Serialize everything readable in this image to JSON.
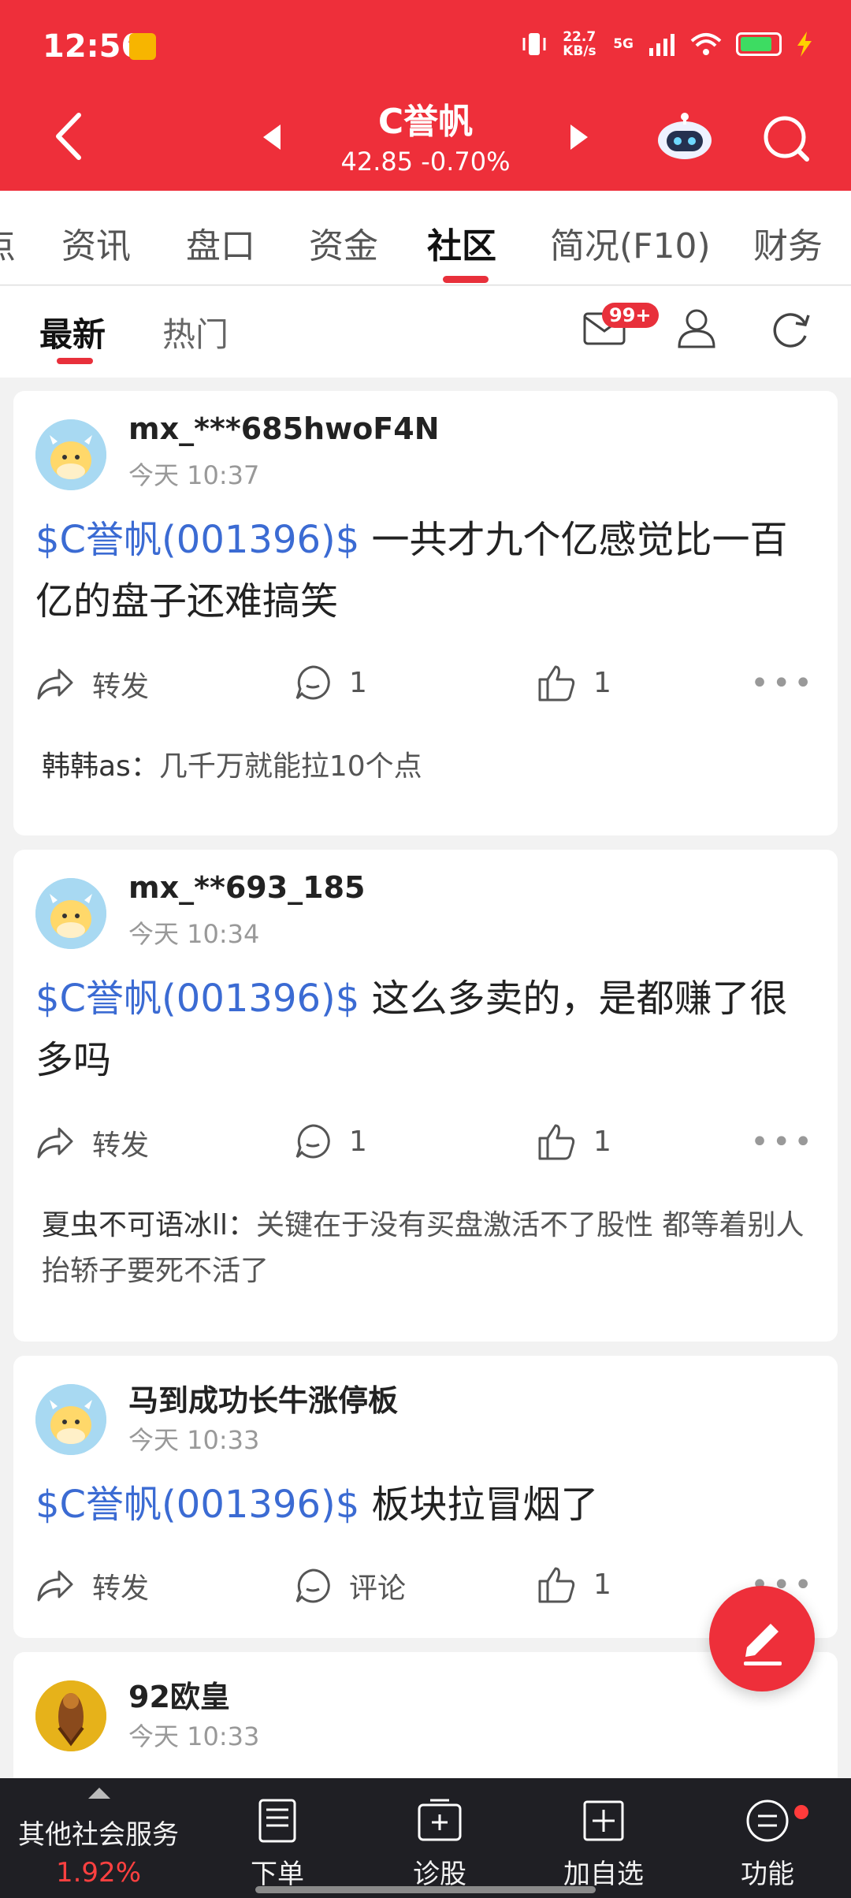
{
  "status_bar": {
    "time": "12:56",
    "net_speed": "22.7 KB/s",
    "network": "5G"
  },
  "header": {
    "stock_name": "C誉帆",
    "price_line": "42.85 -0.70%"
  },
  "tabs": [
    "点",
    "资讯",
    "盘口",
    "资金",
    "社区",
    "简况(F10)",
    "财务"
  ],
  "active_tab": "社区",
  "subtabs": {
    "latest": "最新",
    "hot": "热门"
  },
  "mail_badge": "99+",
  "posts": [
    {
      "user": "mx_***685hwoF4N",
      "time": "今天 10:37",
      "stock_tag": "$C誉帆(001396)$",
      "text": " 一共才九个亿感觉比一百亿的盘子还难搞笑",
      "forward": "转发",
      "comments": "1",
      "likes": "1",
      "reply_name": "韩韩as：",
      "reply_text": "几千万就能拉10个点"
    },
    {
      "user": "mx_**693_185",
      "time": "今天 10:34",
      "stock_tag": "$C誉帆(001396)$",
      "text": " 这么多卖的，是都赚了很多吗",
      "forward": "转发",
      "comments": "1",
      "likes": "1",
      "reply_name": "夏虫不可语冰ll：",
      "reply_text": "关键在于没有买盘激活不了股性 都等着别人抬轿子要死不活了"
    },
    {
      "user": "马到成功长牛涨停板",
      "time": "今天 10:33",
      "stock_tag": "$C誉帆(001396)$",
      "text": " 板块拉冒烟了",
      "forward": "转发",
      "comments": "评论",
      "likes": "1"
    },
    {
      "user": "92欧皇",
      "time": "今天 10:33"
    }
  ],
  "bottom_bar": {
    "other_label": "其他社会服务",
    "other_pct": "1.92%",
    "items": [
      "下单",
      "诊股",
      "加自选",
      "功能"
    ]
  },
  "colors": {
    "brand_red": "#ee2f3a",
    "link_blue": "#3b6bd3",
    "bottom_bg": "#1f1f24"
  }
}
